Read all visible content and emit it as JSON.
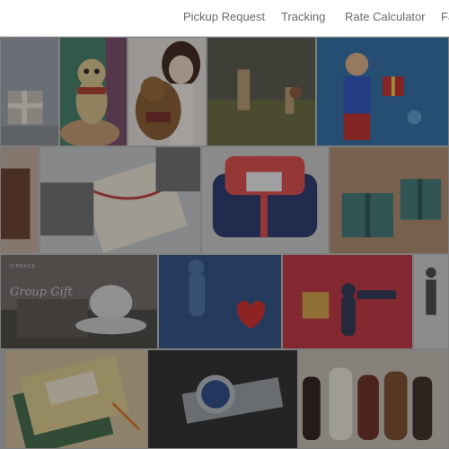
{
  "nav": {
    "links": [
      {
        "label": "Pickup Request"
      },
      {
        "label": "Tracking"
      },
      {
        "label": "Rate Calculator"
      },
      {
        "label": "Fa"
      }
    ]
  },
  "gallery": {
    "group_gift_tile": {
      "label": "Group Gift",
      "brand": "ZIBBAGE"
    }
  },
  "colors": {
    "nav_bg": "#ffffff",
    "nav_text": "#6a6a6a",
    "overlay": "rgba(25,25,25,0.38)"
  }
}
